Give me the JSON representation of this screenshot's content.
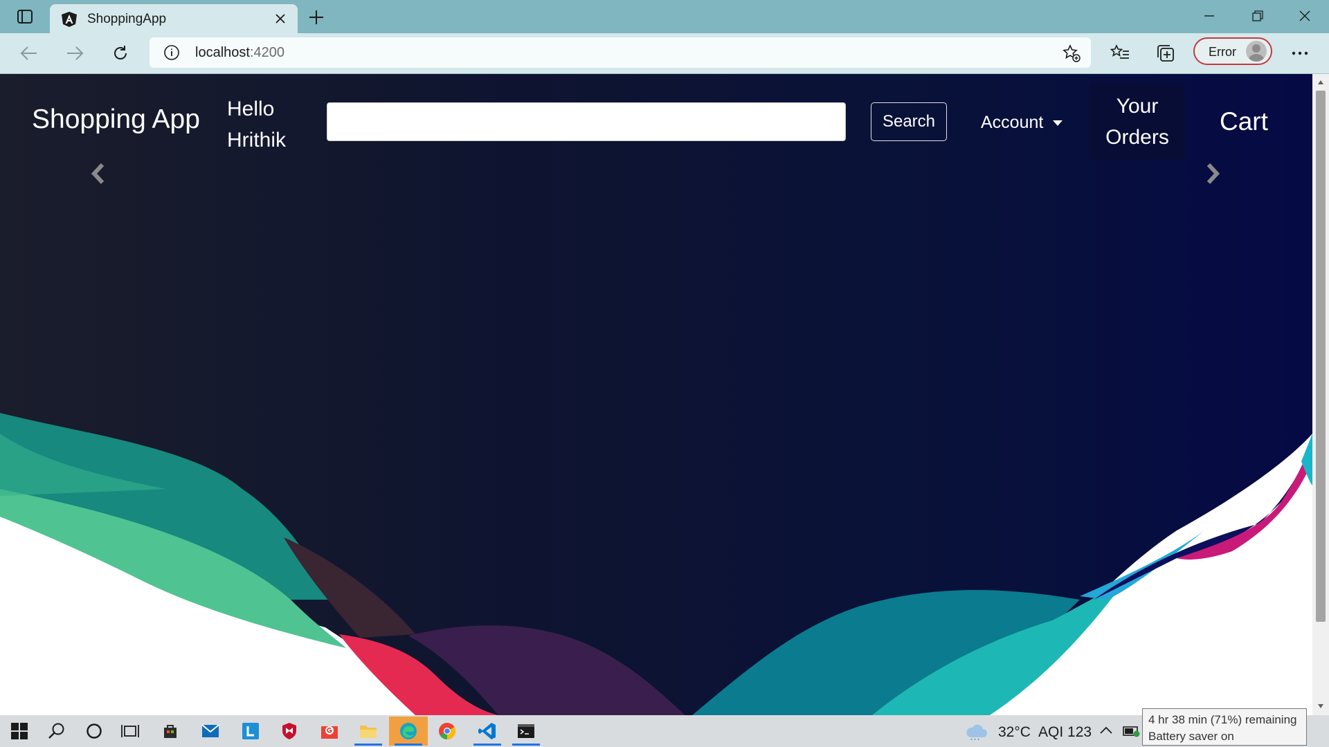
{
  "browser": {
    "tab_title": "ShoppingApp",
    "address_host": "localhost",
    "address_port": ":4200",
    "profile_label": "Error"
  },
  "navbar": {
    "brand": "Shopping App",
    "greeting_line1": "Hello",
    "greeting_line2": "Hrithik",
    "search_placeholder": "",
    "search_button": "Search",
    "account_label": "Account",
    "orders_line1": "Your",
    "orders_line2": "Orders",
    "cart_label": "Cart"
  },
  "taskbar": {
    "temperature": "32°C",
    "aqi": "AQI 123",
    "battery_tooltip_line1": "4 hr 38 min (71%) remaining",
    "battery_tooltip_line2": "Battery saver on"
  },
  "colors": {
    "titlebar": "#7fb6bf",
    "toolbar": "#d5e8eb",
    "page_bg_dark": "#0e1430",
    "profile_border": "#c3393f"
  }
}
